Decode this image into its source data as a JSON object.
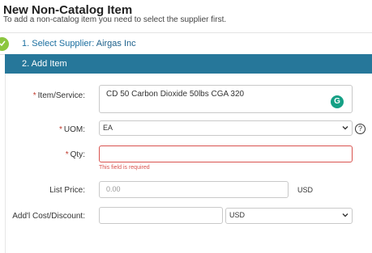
{
  "header": {
    "title": "New Non-Catalog Item",
    "subtitle": "To add a non-catalog item you need to select the supplier first."
  },
  "steps": {
    "step1_prefix": "1. Select Supplier:",
    "step1_value": "Airgas Inc",
    "step2_label": "2. Add Item"
  },
  "form": {
    "item_label": "Item/Service:",
    "item_value": "CD 50 Carbon Dioxide 50lbs CGA 320",
    "uom_label": "UOM:",
    "uom_value": "EA",
    "qty_label": "Qty:",
    "qty_value": "",
    "qty_error": "This field is required",
    "list_price_label": "List Price:",
    "list_price_placeholder": "0.00",
    "list_price_currency": "USD",
    "addl_cost_label": "Add'l Cost/Discount:",
    "addl_cost_value": "",
    "currency_value": "USD",
    "required_marker": "*",
    "help_glyph": "?",
    "grammarly_glyph": "G"
  },
  "colors": {
    "step2_bg": "#26779a",
    "check": "#8cc63f",
    "error": "#d9534f"
  }
}
